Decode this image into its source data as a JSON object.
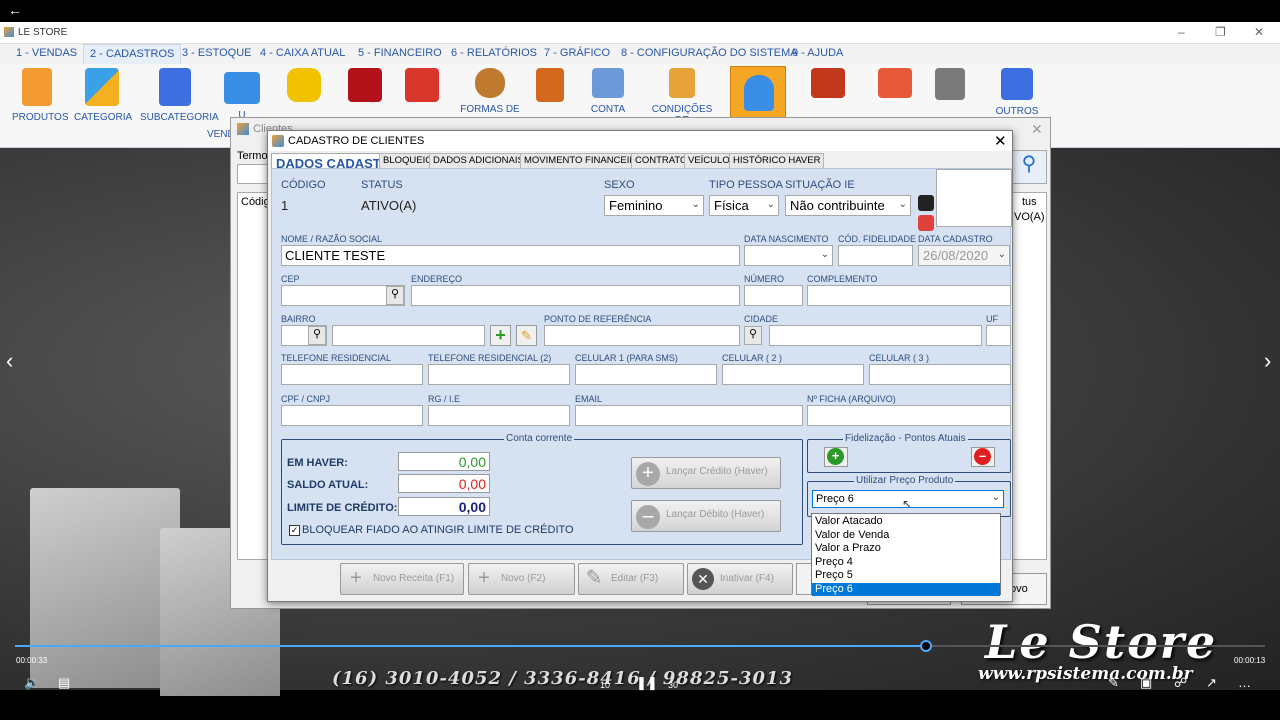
{
  "app": {
    "title": "LE STORE"
  },
  "menu": [
    "1 - VENDAS",
    "2 - CADASTROS",
    "3 - ESTOQUE",
    "4 - CAIXA ATUAL",
    "5 - FINANCEIRO",
    "6 - RELATÓRIOS",
    "7 - GRÁFICO",
    "8 - CONFIGURAÇÃO DO SISTEMA",
    "9 - AJUDA"
  ],
  "ribbon": {
    "produtos": "PRODUTOS",
    "categoria": "CATEGORIA",
    "subcategoria": "SUBCATEGORIA",
    "u": "U",
    "formas": "FORMAS DE",
    "conta": "CONTA",
    "condicoes": "CONDIÇÕES DE",
    "outros": "OUTROS",
    "vend": "VEND"
  },
  "clientes_window": {
    "title": "Clientes",
    "termo": "Termo",
    "codigo": "Códig",
    "status_col": "tus",
    "status_val": "VO(A)",
    "novo": "ovo"
  },
  "dialog": {
    "title": "CADASTRO DE CLIENTES",
    "tabs": [
      "DADOS CADASTRAIS",
      "BLOQUEIO",
      "DADOS ADICIONAIS",
      "MOVIMENTO FINANCEIRO",
      "CONTRATO",
      "VEÍCULOS",
      "HISTÓRICO HAVER"
    ],
    "codigo_label": "CÓDIGO",
    "codigo_value": "1",
    "status_label": "STATUS",
    "status_value": "ATIVO(A)",
    "sexo_label": "SEXO",
    "sexo_value": "Feminino",
    "tipo_label": "TIPO PESSOA",
    "tipo_value": "Física",
    "situacao_label": "SITUAÇÃO IE",
    "situacao_value": "Não contribuinte",
    "nome_label": "NOME / RAZÃO SOCIAL",
    "nome_value": "CLIENTE TESTE",
    "nasc_label": "DATA NASCIMENTO",
    "fid_label": "CÓD. FIDELIDADE",
    "cad_label": "DATA CADASTRO",
    "cad_value": "26/08/2020",
    "cep_label": "CEP",
    "endereco_label": "ENDEREÇO",
    "numero_label": "NÚMERO",
    "complemento_label": "COMPLEMENTO",
    "bairro_label": "BAIRRO",
    "ponto_label": "PONTO DE REFERÊNCIA",
    "cidade_label": "CIDADE",
    "uf_label": "UF",
    "tel1_label": "TELEFONE RESIDENCIAL",
    "tel2_label": "TELEFONE RESIDENCIAL (2)",
    "cel1_label": "CELULAR 1 (PARA SMS)",
    "cel2_label": "CELULAR ( 2 )",
    "cel3_label": "CELULAR ( 3 )",
    "cpf_label": "CPF / CNPJ",
    "rg_label": "RG / I.E",
    "email_label": "EMAIL",
    "ficha_label": "Nº FICHA (ARQUIVO)",
    "conta_title": "Conta corrente",
    "haver_label": "EM HAVER:",
    "haver_value": "0,00",
    "saldo_label": "SALDO ATUAL:",
    "saldo_value": "0,00",
    "limite_label": "LIMITE DE CRÉDITO:",
    "limite_value": "0,00",
    "bloquear_label": "BLOQUEAR FIADO AO ATINGIR LIMITE DE CRÉDITO",
    "lancar_credito": "Lançar Crédito (Haver)",
    "lancar_debito": "Lançar Débito (Haver)",
    "fidel_title": "Fidelização - Pontos Atuais",
    "preco_title": "Utilizar Preço Produto",
    "preco_value": "Preço 6",
    "preco_options": [
      "Valor Atacado",
      "Valor de Venda",
      "Valor a Prazo",
      "Preço 4",
      "Preço 5",
      "Preço 6"
    ],
    "footer": [
      "Novo Receita (F1)",
      "Novo (F2)",
      "Editar (F3)",
      "Inativar (F4)"
    ]
  },
  "player": {
    "time_left": "00:00:33",
    "time_right": "00:00:13",
    "brand": "Le Store",
    "site": "www.rpsistema.com.br",
    "phones": "(16) 3010-4052 / 3336-8416 / 98825-3013",
    "skip_back": "10",
    "skip_fwd": "30"
  },
  "colors": {
    "accent": "#2757a8",
    "panel": "#d6e2f2",
    "highlight": "#0078d7",
    "red": "#e02020",
    "green": "#2a9a2a"
  }
}
